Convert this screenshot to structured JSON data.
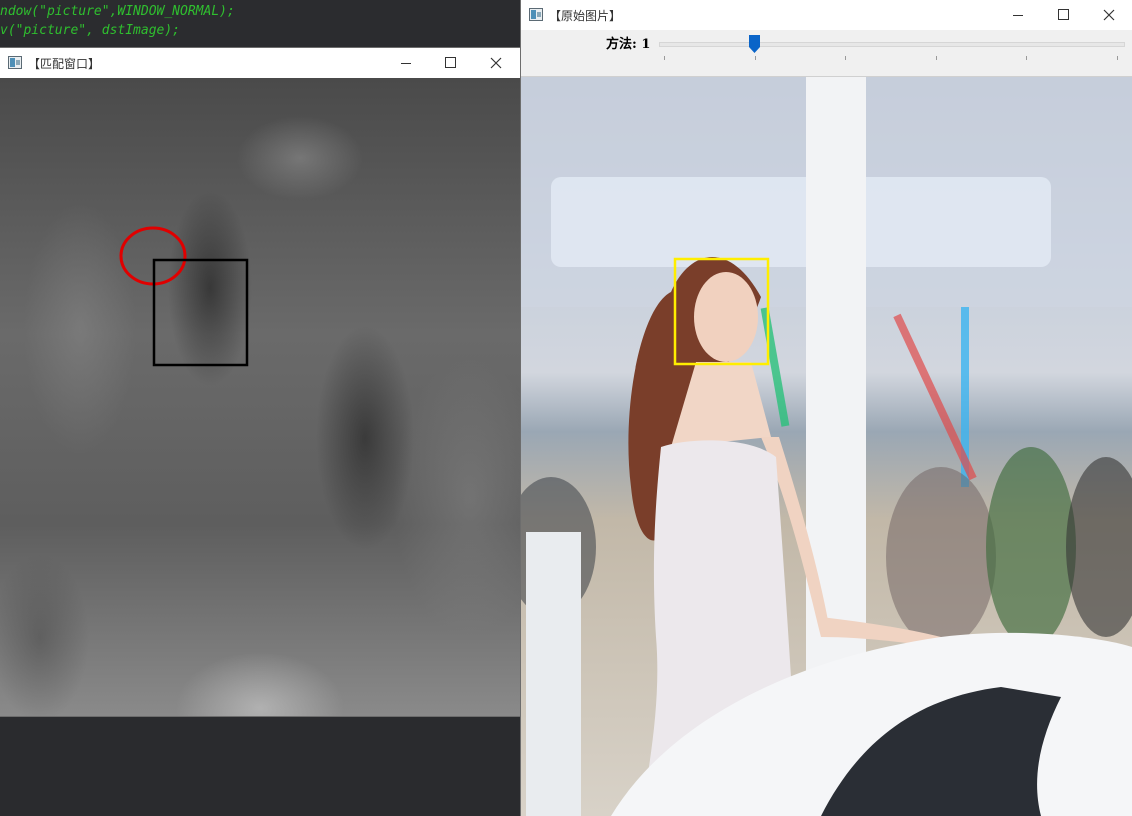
{
  "editor": {
    "line1": "ndow(\"picture\",WINDOW_NORMAL);",
    "line2": "v(\"picture\", dstImage);"
  },
  "left_window": {
    "title": "【匹配窗口】",
    "match_marker_color": "#e00000",
    "match_rect_color": "#000000"
  },
  "right_window": {
    "title": "【原始图片】",
    "trackbar": {
      "label": "方法: 1",
      "value": 1,
      "min": 0,
      "max": 5
    },
    "face_rect_color": "#ffee00"
  },
  "icons": {
    "window": "opencv-window-icon",
    "minimize": "minimize-icon",
    "maximize": "maximize-icon",
    "close": "close-icon"
  }
}
